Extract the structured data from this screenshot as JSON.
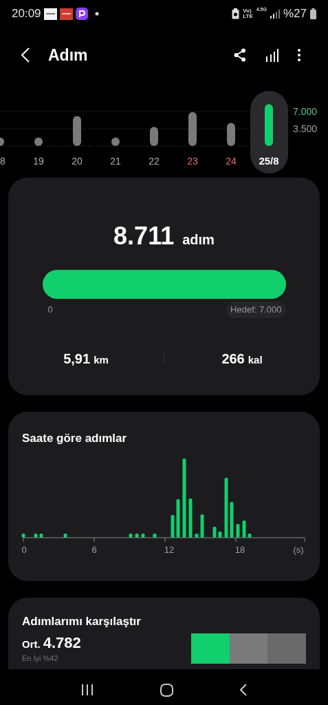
{
  "status_bar": {
    "time": "20:09",
    "volte_top": "Vo)",
    "volte_bottom": "LTE",
    "network": "4.5G",
    "battery": "%27"
  },
  "header": {
    "title": "Adım"
  },
  "week": {
    "chart_data": {
      "type": "bar",
      "categories": [
        "8",
        "19",
        "20",
        "21",
        "22",
        "23",
        "24",
        "25/8"
      ],
      "stacked": true,
      "series": [
        {
          "color": "#7a7a7a",
          "values": [
            1.7,
            1.7,
            6.1,
            1.7,
            3.9,
            6.9,
            4.7,
            null
          ]
        },
        {
          "color": "#12cf6e",
          "values": [
            null,
            null,
            null,
            null,
            null,
            null,
            null,
            8.5
          ]
        }
      ],
      "ylim": [
        0,
        9
      ],
      "yticks": [
        {
          "value": 3.5,
          "label": "3.500"
        },
        {
          "value": 7,
          "label": "7.000"
        }
      ]
    },
    "days": [
      {
        "weekend": false,
        "selected": false
      },
      {
        "weekend": false,
        "selected": false
      },
      {
        "weekend": false,
        "selected": false
      },
      {
        "weekend": false,
        "selected": false
      },
      {
        "weekend": false,
        "selected": false
      },
      {
        "weekend": true,
        "selected": false
      },
      {
        "weekend": true,
        "selected": false
      },
      {
        "weekend": false,
        "selected": true
      }
    ]
  },
  "summary": {
    "steps": "8.711",
    "steps_unit": "adım",
    "level": 1,
    "min_label": "0",
    "goal_label": "Hedef: 7.000",
    "distance": "5,91",
    "distance_unit": "km",
    "calories": "266",
    "calories_unit": "kal"
  },
  "hourly": {
    "title": "Saate göre adımlar",
    "xticks": [
      "0",
      "6",
      "12",
      "18",
      "(s)"
    ]
  },
  "compare": {
    "title": "Adımlarımı karşılaştır",
    "avg_label": "Ort.",
    "avg_value": "4.782",
    "best": "En İyi %42"
  }
}
